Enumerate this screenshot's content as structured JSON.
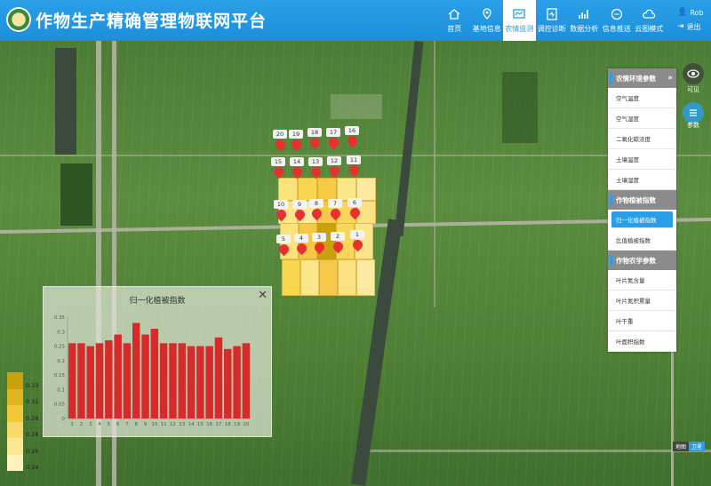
{
  "app": {
    "title": "作物生产精确管理物联网平台"
  },
  "nav": {
    "items": [
      {
        "label": "首页",
        "icon": "home-icon"
      },
      {
        "label": "基地信息",
        "icon": "location-pin-icon"
      },
      {
        "label": "农情监测",
        "icon": "monitor-icon",
        "active": true
      },
      {
        "label": "调控诊断",
        "icon": "diagnosis-icon"
      },
      {
        "label": "数据分析",
        "icon": "bar-chart-icon"
      },
      {
        "label": "信息推送",
        "icon": "message-icon"
      },
      {
        "label": "云图模式",
        "icon": "cloud-icon"
      }
    ]
  },
  "user": {
    "name": "Rob",
    "logout": "退出"
  },
  "colors": {
    "brand": "#2a9fe8",
    "marker": "#e5322d",
    "bar": "#d52b2b"
  },
  "markers": [
    "20",
    "19",
    "18",
    "17",
    "16",
    "15",
    "14",
    "13",
    "12",
    "11",
    "10",
    "9",
    "8",
    "7",
    "6",
    "5",
    "4",
    "3",
    "2",
    "1"
  ],
  "right_panel": {
    "sections": [
      {
        "title": "农情环境参数",
        "items": [
          "空气温度",
          "空气湿度",
          "二氧化碳浓度",
          "土壤温度",
          "土壤湿度"
        ]
      },
      {
        "title": "作物植被指数",
        "items": [
          "归一化植被指数",
          "比值植被指数"
        ],
        "active": "归一化植被指数"
      },
      {
        "title": "作物农学参数",
        "items": [
          "叶片氮含量",
          "叶片氮积累量",
          "叶干重",
          "叶面积指数"
        ]
      }
    ]
  },
  "map_tools": [
    {
      "label": "可见",
      "icon": "eye-icon"
    },
    {
      "label": "参数",
      "icon": "parameters-icon"
    }
  ],
  "basemap": {
    "map": "地图",
    "satellite": "卫星"
  },
  "legend": [
    "0.33",
    "0.31",
    "0.29",
    "0.28",
    "0.26",
    "0.24"
  ],
  "chart_data": {
    "type": "bar",
    "title": "归一化植被指数",
    "categories": [
      "1",
      "2",
      "3",
      "4",
      "5",
      "6",
      "7",
      "8",
      "9",
      "10",
      "11",
      "12",
      "13",
      "14",
      "15",
      "16",
      "17",
      "18",
      "19",
      "20"
    ],
    "values": [
      0.26,
      0.26,
      0.25,
      0.26,
      0.27,
      0.29,
      0.26,
      0.33,
      0.29,
      0.31,
      0.26,
      0.26,
      0.26,
      0.25,
      0.25,
      0.25,
      0.28,
      0.24,
      0.25,
      0.26
    ],
    "ylim": [
      0,
      0.35
    ],
    "yticks": [
      "0",
      "0.05",
      "0.1",
      "0.15",
      "0.2",
      "0.25",
      "0.3",
      "0.35"
    ],
    "grid": true
  }
}
